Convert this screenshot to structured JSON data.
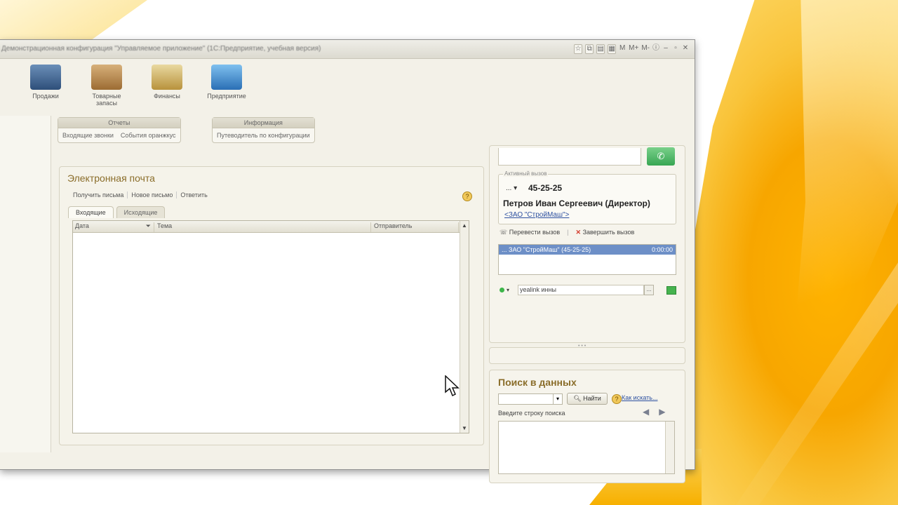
{
  "window": {
    "title": "Демонстрационная конфигурация \"Управляемое приложение\" (1С:Предприятие, учебная версия)",
    "title_icons": [
      "☆",
      "⧉",
      "▤",
      "▦",
      "M",
      "M+",
      "M-",
      "ⓘ",
      "–",
      "▫",
      "✕"
    ]
  },
  "sections": [
    {
      "label": "Продажи",
      "icon": "cash-register-icon"
    },
    {
      "label": "Товарные запасы",
      "icon": "box-icon"
    },
    {
      "label": "Финансы",
      "icon": "coins-icon"
    },
    {
      "label": "Предприятие",
      "icon": "building-icon"
    }
  ],
  "command_groups": {
    "reports": {
      "header": "Отчеты",
      "items": [
        "Входящие звонки",
        "События оранжкус"
      ]
    },
    "info": {
      "header": "Информация",
      "items": [
        "Путеводитель по конфигурации"
      ]
    }
  },
  "mail": {
    "heading": "Электронная почта",
    "actions": [
      "Получить письма",
      "Новое письмо",
      "Ответить"
    ],
    "help": "?",
    "tabs": [
      "Входящие",
      "Исходящие"
    ],
    "columns": [
      "Дата",
      "Тема",
      "Отправитель"
    ],
    "scroll_up": "▲",
    "scroll_down": "▼"
  },
  "telephony": {
    "call_icon": "✆",
    "active_call_legend": "Активный вызов",
    "dots": "... ▾",
    "phone": "45-25-25",
    "person": "Петров Иван Сергеевич (Директор)",
    "organization": "<ЗАО \"СтройМаш\">",
    "transfer_label": "Перевести вызов",
    "end_label": "Завершить вызов",
    "end_icon": "✕",
    "calls": [
      {
        "name": "... ЗАО \"СтройМаш\" (45-25-25)",
        "time": "0:00:00"
      }
    ],
    "line_value": "yealink инны",
    "line_button": "...",
    "status_arrow": "▾",
    "splitter_dots": "• • •"
  },
  "search": {
    "heading": "Поиск в данных",
    "combo_arrow": "▾",
    "find_label": "Найти",
    "how_label": "Как искать...",
    "hint": "Введите строку поиска",
    "prev": "◀",
    "next": "▶"
  },
  "colors": {
    "accent_heading": "#8a6d2a",
    "call_green": "#38a653",
    "selected_row": "#6d8fc7",
    "background_orange": "#f7a600"
  }
}
